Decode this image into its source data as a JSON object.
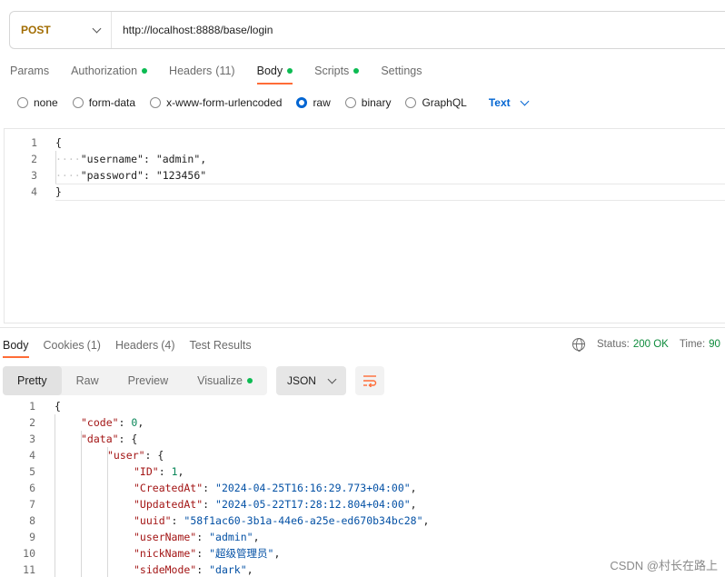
{
  "request": {
    "method": "POST",
    "url": "http://localhost:8888/base/login",
    "tabs": [
      {
        "label": "Params",
        "count": "",
        "dot": false
      },
      {
        "label": "Authorization",
        "count": "",
        "dot": true
      },
      {
        "label": "Headers",
        "count": "(11)",
        "dot": false
      },
      {
        "label": "Body",
        "count": "",
        "dot": true
      },
      {
        "label": "Scripts",
        "count": "",
        "dot": true
      },
      {
        "label": "Settings",
        "count": "",
        "dot": false
      }
    ],
    "active_tab": "Body",
    "body_types": [
      "none",
      "form-data",
      "x-www-form-urlencoded",
      "raw",
      "binary",
      "GraphQL"
    ],
    "selected_body_type": "raw",
    "language": "Text",
    "body_lines": [
      {
        "n": "1",
        "text": "{"
      },
      {
        "n": "2",
        "key": "\"username\"",
        "sep": ": ",
        "val": "\"admin\"",
        "end": ","
      },
      {
        "n": "3",
        "key": "\"password\"",
        "sep": ": ",
        "val": "\"123456\"",
        "end": ""
      },
      {
        "n": "4",
        "text": "}"
      }
    ]
  },
  "response": {
    "tabs": [
      {
        "label": "Body",
        "count": ""
      },
      {
        "label": "Cookies",
        "count": "(1)"
      },
      {
        "label": "Headers",
        "count": "(4)"
      },
      {
        "label": "Test Results",
        "count": ""
      }
    ],
    "status_label": "Status:",
    "status_value": "200 OK",
    "time_label": "Time:",
    "time_value": "90",
    "views": [
      "Pretty",
      "Raw",
      "Preview",
      "Visualize"
    ],
    "active_view": "Pretty",
    "format": "JSON",
    "lines": [
      {
        "n": "1",
        "indent": 0,
        "parts": [
          [
            "p",
            "{"
          ]
        ]
      },
      {
        "n": "2",
        "indent": 1,
        "parts": [
          [
            "k",
            "\"code\""
          ],
          [
            "p",
            ": "
          ],
          [
            "n",
            "0"
          ],
          [
            "p",
            ","
          ]
        ]
      },
      {
        "n": "3",
        "indent": 1,
        "parts": [
          [
            "k",
            "\"data\""
          ],
          [
            "p",
            ": {"
          ]
        ]
      },
      {
        "n": "4",
        "indent": 2,
        "parts": [
          [
            "k",
            "\"user\""
          ],
          [
            "p",
            ": {"
          ]
        ]
      },
      {
        "n": "5",
        "indent": 3,
        "parts": [
          [
            "k",
            "\"ID\""
          ],
          [
            "p",
            ": "
          ],
          [
            "n",
            "1"
          ],
          [
            "p",
            ","
          ]
        ]
      },
      {
        "n": "6",
        "indent": 3,
        "parts": [
          [
            "k",
            "\"CreatedAt\""
          ],
          [
            "p",
            ": "
          ],
          [
            "s",
            "\"2024-04-25T16:16:29.773+04:00\""
          ],
          [
            "p",
            ","
          ]
        ]
      },
      {
        "n": "7",
        "indent": 3,
        "parts": [
          [
            "k",
            "\"UpdatedAt\""
          ],
          [
            "p",
            ": "
          ],
          [
            "s",
            "\"2024-05-22T17:28:12.804+04:00\""
          ],
          [
            "p",
            ","
          ]
        ]
      },
      {
        "n": "8",
        "indent": 3,
        "parts": [
          [
            "k",
            "\"uuid\""
          ],
          [
            "p",
            ": "
          ],
          [
            "s",
            "\"58f1ac60-3b1a-44e6-a25e-ed670b34bc28\""
          ],
          [
            "p",
            ","
          ]
        ]
      },
      {
        "n": "9",
        "indent": 3,
        "parts": [
          [
            "k",
            "\"userName\""
          ],
          [
            "p",
            ": "
          ],
          [
            "s",
            "\"admin\""
          ],
          [
            "p",
            ","
          ]
        ]
      },
      {
        "n": "10",
        "indent": 3,
        "parts": [
          [
            "k",
            "\"nickName\""
          ],
          [
            "p",
            ": "
          ],
          [
            "s",
            "\"超级管理员\""
          ],
          [
            "p",
            ","
          ]
        ]
      },
      {
        "n": "11",
        "indent": 3,
        "parts": [
          [
            "k",
            "\"sideMode\""
          ],
          [
            "p",
            ": "
          ],
          [
            "s",
            "\"dark\""
          ],
          [
            "p",
            ","
          ]
        ]
      }
    ]
  },
  "watermark": "CSDN @村长在路上",
  "colors": {
    "accent": "#ff6c37",
    "method": "#a26d03",
    "link": "#0265d2",
    "dot": "#0cbb52",
    "status_ok": "#0d8b3b"
  },
  "icons": [
    "chevron-down-icon",
    "globe-icon",
    "wrap-lines-icon"
  ]
}
